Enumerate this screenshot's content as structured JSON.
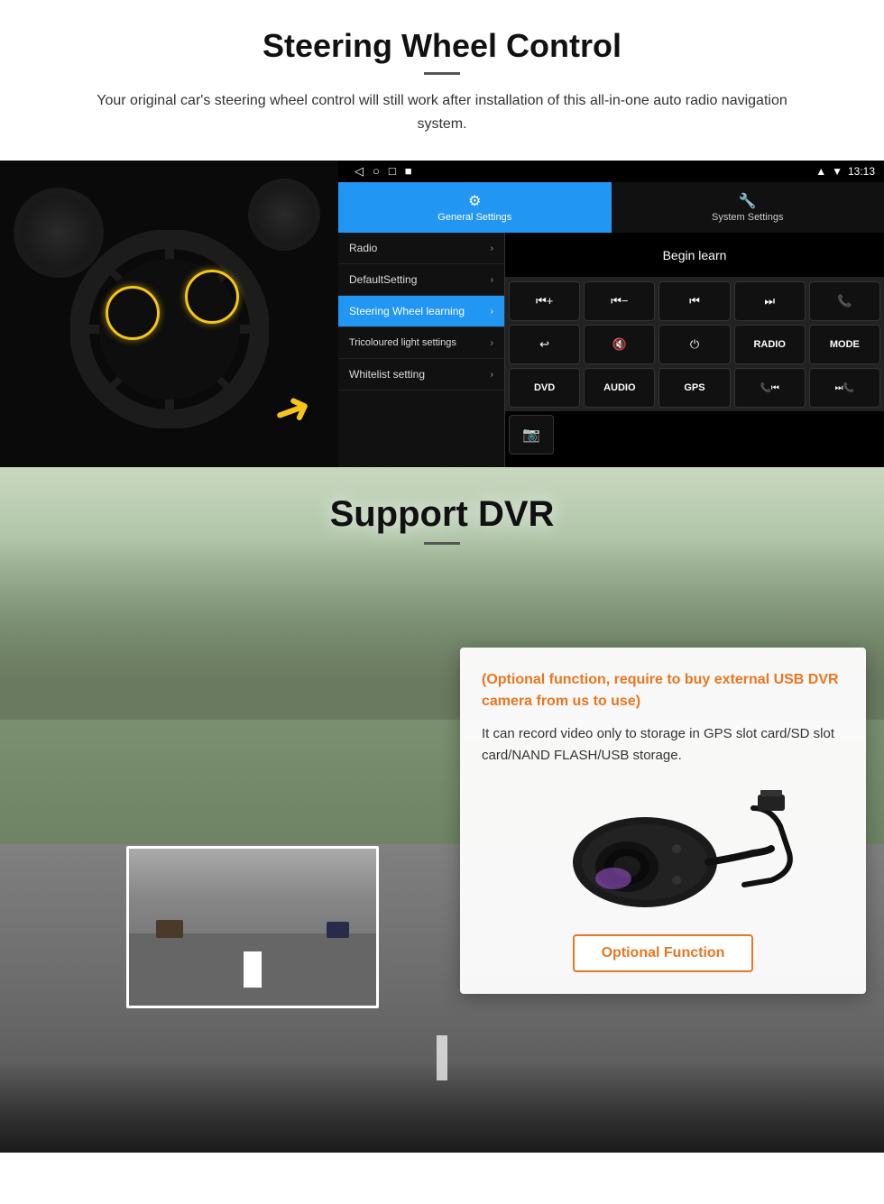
{
  "section1": {
    "title": "Steering Wheel Control",
    "description": "Your original car's steering wheel control will still work after installation of this all-in-one auto radio navigation system.",
    "android_ui": {
      "status_bar": {
        "time": "13:13",
        "nav_icons": [
          "◁",
          "○",
          "□",
          "■"
        ]
      },
      "tabs": [
        {
          "label": "General Settings",
          "active": true
        },
        {
          "label": "System Settings",
          "active": false
        }
      ],
      "menu_items": [
        {
          "label": "Radio",
          "active": false
        },
        {
          "label": "DefaultSetting",
          "active": false
        },
        {
          "label": "Steering Wheel learning",
          "active": true
        },
        {
          "label": "Tricoloured light settings",
          "active": false
        },
        {
          "label": "Whitelist setting",
          "active": false
        }
      ],
      "begin_learn": "Begin learn",
      "controls": [
        {
          "icon": "⏮+",
          "type": "vol_up"
        },
        {
          "icon": "⏮-",
          "type": "vol_down"
        },
        {
          "icon": "⏮",
          "type": "prev_track"
        },
        {
          "icon": "⏭",
          "type": "next_track"
        },
        {
          "icon": "📞",
          "type": "phone"
        },
        {
          "icon": "↩",
          "type": "hang_up"
        },
        {
          "icon": "🔇",
          "type": "mute"
        },
        {
          "icon": "⏻",
          "type": "power"
        },
        {
          "text": "RADIO",
          "type": "radio"
        },
        {
          "text": "MODE",
          "type": "mode"
        },
        {
          "text": "DVD",
          "type": "dvd"
        },
        {
          "text": "AUDIO",
          "type": "audio"
        },
        {
          "text": "GPS",
          "type": "gps"
        },
        {
          "icon": "📞⏮",
          "type": "phone_prev"
        },
        {
          "icon": "⏭📞",
          "type": "phone_next"
        }
      ],
      "bottom_icon": "📷"
    }
  },
  "section2": {
    "title": "Support DVR",
    "optional_text": "(Optional function, require to buy external USB DVR camera from us to use)",
    "description": "It can record video only to storage in GPS slot card/SD slot card/NAND FLASH/USB storage.",
    "optional_button": "Optional Function"
  }
}
